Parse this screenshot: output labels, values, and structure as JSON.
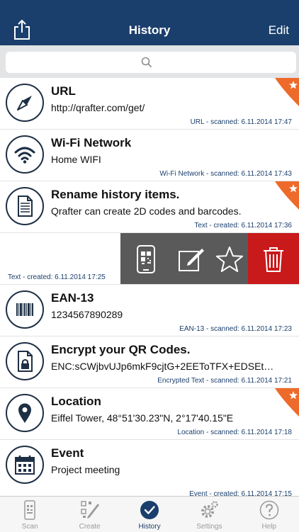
{
  "nav": {
    "title": "History",
    "edit_label": "Edit"
  },
  "search": {
    "placeholder": ""
  },
  "items": [
    {
      "title": "URL",
      "subtitle": "http://qrafter.com/get/",
      "meta": "URL - scanned: 6.11.2014 17:47",
      "favorite": true
    },
    {
      "title": "Wi-Fi Network",
      "subtitle": "Home WIFI",
      "meta": "Wi-Fi Network - scanned: 6.11.2014 17:43",
      "favorite": false
    },
    {
      "title": "Rename history items.",
      "subtitle": "Qrafter can create 2D codes and barcodes.",
      "meta": "Text - created: 6.11.2014 17:36",
      "favorite": true
    },
    {
      "meta": "Text - created: 6.11.2014 17:25"
    },
    {
      "title": "EAN-13",
      "subtitle": "1234567890289",
      "meta": "EAN-13 - scanned: 6.11.2014 17:23",
      "favorite": false
    },
    {
      "title": "Encrypt your QR Codes.",
      "subtitle": "ENC:sCWjbvUJp6mkF9cjtG+2EEToTFX+EDSEt…",
      "meta": "Encrypted Text - scanned: 6.11.2014 17:21",
      "favorite": false
    },
    {
      "title": "Location",
      "subtitle": "Eiffel Tower, 48°51'30.23\"N, 2°17'40.15\"E",
      "meta": "Location - scanned: 6.11.2014 17:18",
      "favorite": true
    },
    {
      "title": "Event",
      "subtitle": "Project meeting",
      "meta": "Event - created: 6.11.2014 17:15",
      "favorite": false
    }
  ],
  "tabs": [
    {
      "label": "Scan"
    },
    {
      "label": "Create"
    },
    {
      "label": "History"
    },
    {
      "label": "Settings"
    },
    {
      "label": "Help"
    }
  ],
  "colors": {
    "navbar": "#1b3f6c",
    "favorite": "#ee6a2a",
    "delete": "#c8191b",
    "swipe_actions": "#5a5a5a"
  }
}
